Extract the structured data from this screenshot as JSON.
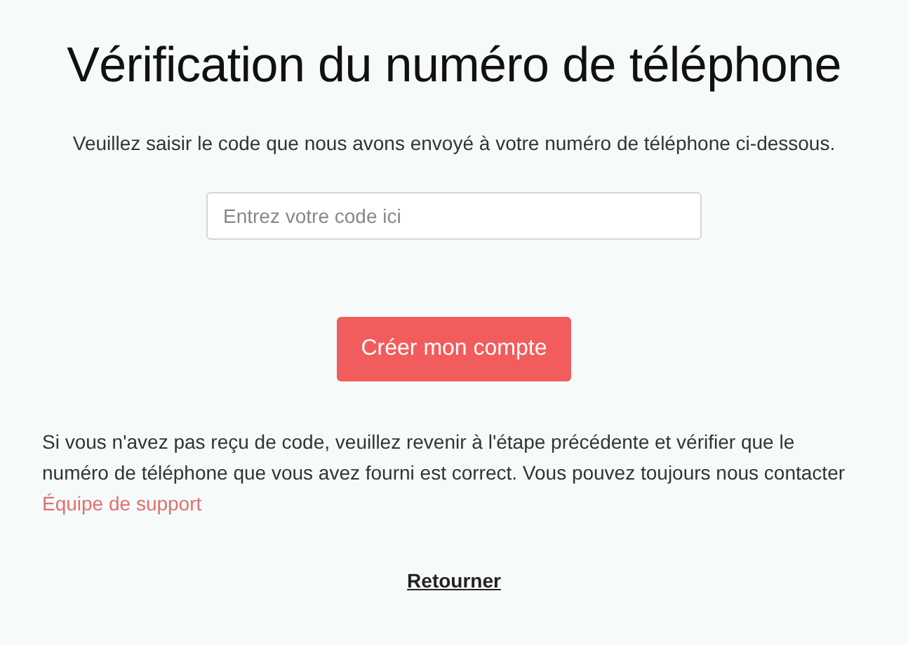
{
  "title": "Vérification du numéro de téléphone",
  "instructions": "Veuillez saisir le code que nous avons envoyé à votre numéro de téléphone ci-dessous.",
  "code_field": {
    "placeholder": "Entrez votre code ici"
  },
  "submit_button": "Créer mon compte",
  "help": {
    "text": "Si vous n'avez pas reçu de code, veuillez revenir à l'étape précédente et vérifier que le numéro de téléphone que vous avez fourni est correct. Vous pouvez toujours nous contacter",
    "link": "Équipe de support"
  },
  "back_link": "Retourner"
}
